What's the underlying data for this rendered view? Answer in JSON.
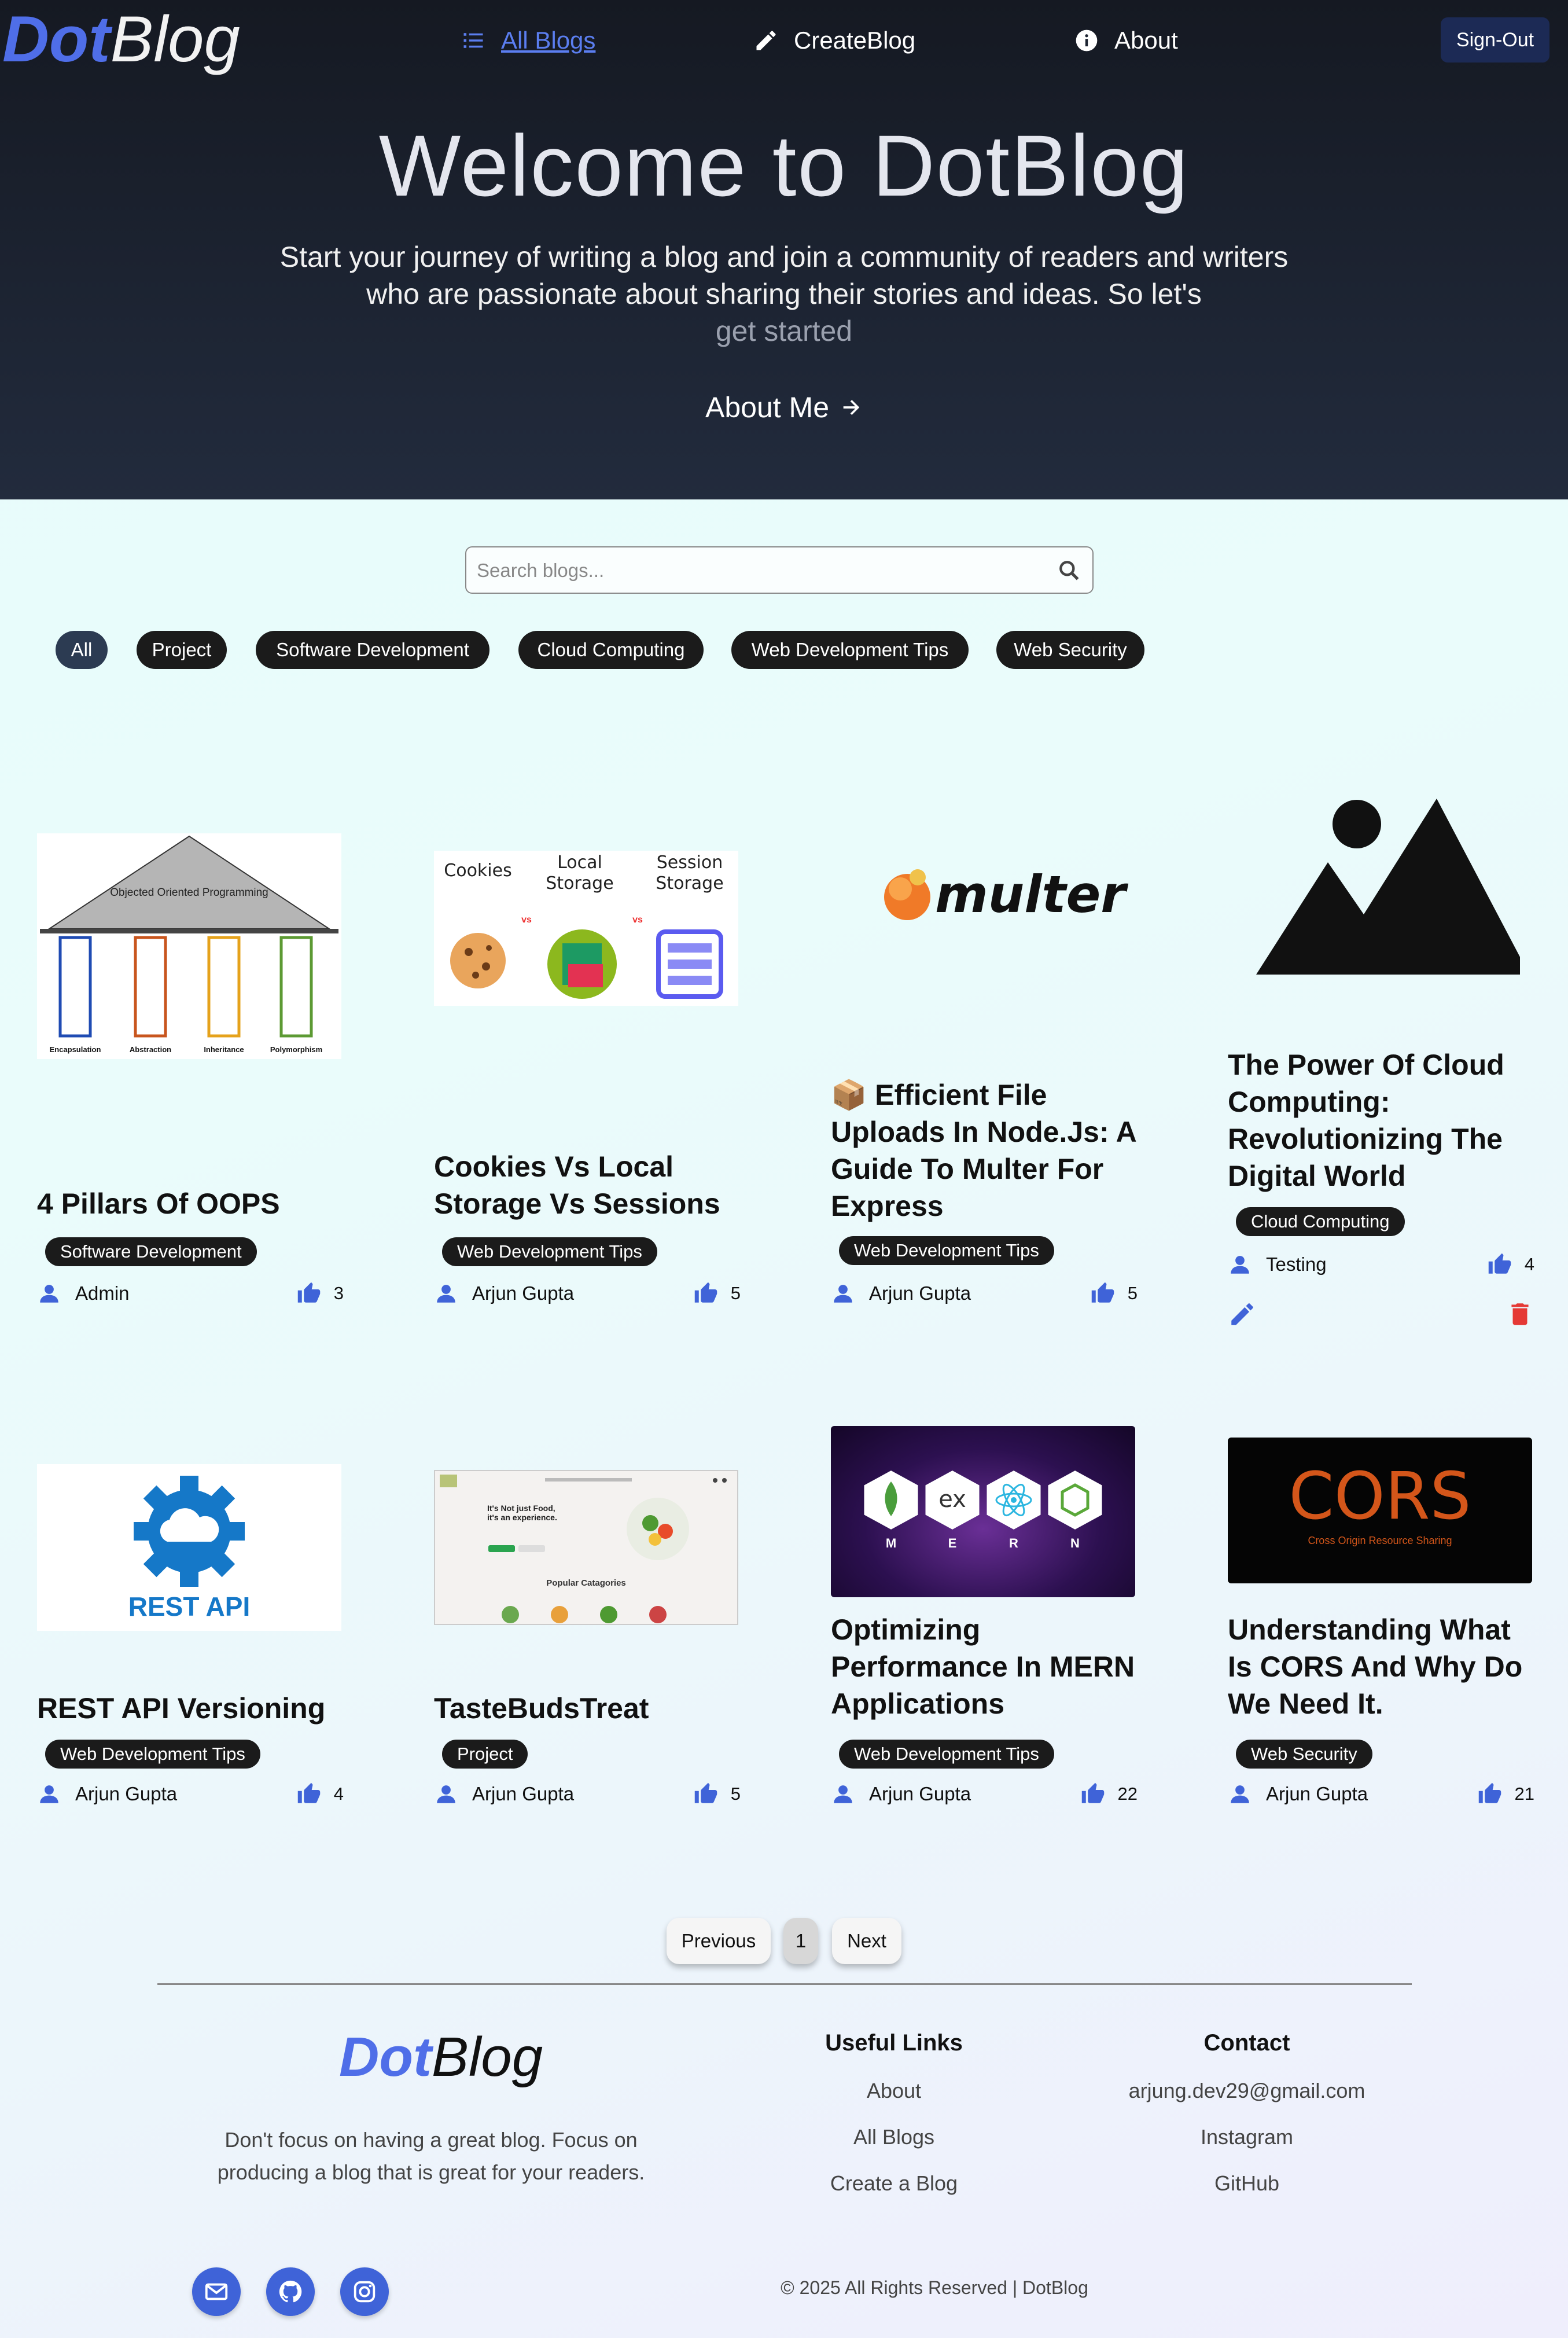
{
  "brand": {
    "dot": "Dot",
    "blog": "Blog"
  },
  "nav": {
    "all_blogs": "All Blogs",
    "create_blog": "CreateBlog",
    "about": "About",
    "sign_out": "Sign-Out"
  },
  "hero": {
    "title": "Welcome to DotBlog",
    "subtitle_main": "Start your journey of writing a blog and join a community of readers and writers who are passionate about sharing their stories and ideas. So let's",
    "subtitle_end": "get started",
    "about_me": "About Me"
  },
  "search": {
    "placeholder": "Search blogs..."
  },
  "categories": [
    "All",
    "Project",
    "Software Development",
    "Cloud Computing",
    "Web Development Tips",
    "Web Security"
  ],
  "posts": [
    {
      "title": "4 Pillars Of OOPS",
      "tag": "Software Development",
      "author": "Admin",
      "likes": "3",
      "thumb": {
        "roof": "Objected Oriented Programming",
        "p1": "Encapsulation",
        "p2": "Abstraction",
        "p3": "Inheritance",
        "p4": "Polymorphism"
      }
    },
    {
      "title": "Cookies Vs Local Storage Vs Sessions",
      "tag": "Web Development Tips",
      "author": "Arjun Gupta",
      "likes": "5",
      "thumb": {
        "c1": "Cookies",
        "c2a": "Local",
        "c2b": "Storage",
        "c3a": "Session",
        "c3b": "Storage",
        "vs": "vs"
      }
    },
    {
      "title": "📦 Efficient File Uploads In Node.Js: A Guide To Multer For Express",
      "tag": "Web Development Tips",
      "author": "Arjun Gupta",
      "likes": "5",
      "thumb": {
        "word": "multer"
      }
    },
    {
      "title": "The Power Of Cloud Computing: Revolutionizing The Digital World",
      "tag": "Cloud Computing",
      "author": "Testing",
      "likes": "4"
    },
    {
      "title": "REST API Versioning",
      "tag": "Web Development Tips",
      "author": "Arjun Gupta",
      "likes": "4",
      "thumb": {
        "word": "REST API"
      }
    },
    {
      "title": "TasteBudsTreat",
      "tag": "Project",
      "author": "Arjun Gupta",
      "likes": "5",
      "thumb": {
        "headline": "It's Not just Food, it's an experience.",
        "section": "Popular Catagories"
      }
    },
    {
      "title": "Optimizing Performance In MERN Applications",
      "tag": "Web Development Tips",
      "author": "Arjun Gupta",
      "likes": "22",
      "thumb": {
        "m": "M",
        "e": "E",
        "r": "R",
        "n": "N",
        "ex": "ex"
      }
    },
    {
      "title": "Understanding What Is CORS And Why Do We Need It.",
      "tag": "Web Security",
      "author": "Arjun Gupta",
      "likes": "21",
      "thumb": {
        "word": "CORS",
        "sub": "Cross Origin Resource Sharing"
      }
    }
  ],
  "pagination": {
    "prev": "Previous",
    "current": "1",
    "next": "Next"
  },
  "footer": {
    "tagline": "Don't focus on having a great blog. Focus on producing a blog that is great for your readers.",
    "useful_heading": "Useful Links",
    "useful": [
      "About",
      "All Blogs",
      "Create a Blog"
    ],
    "contact_heading": "Contact",
    "contact": [
      "arjung.dev29@gmail.com",
      "Instagram",
      "GitHub"
    ],
    "copyright": "© 2025 All Rights Reserved | DotBlog"
  },
  "colors": {
    "accent": "#4f6ee8",
    "hero_bg": "#1c2331",
    "delete": "#e53935",
    "tag_bg": "#1b1b1b"
  }
}
